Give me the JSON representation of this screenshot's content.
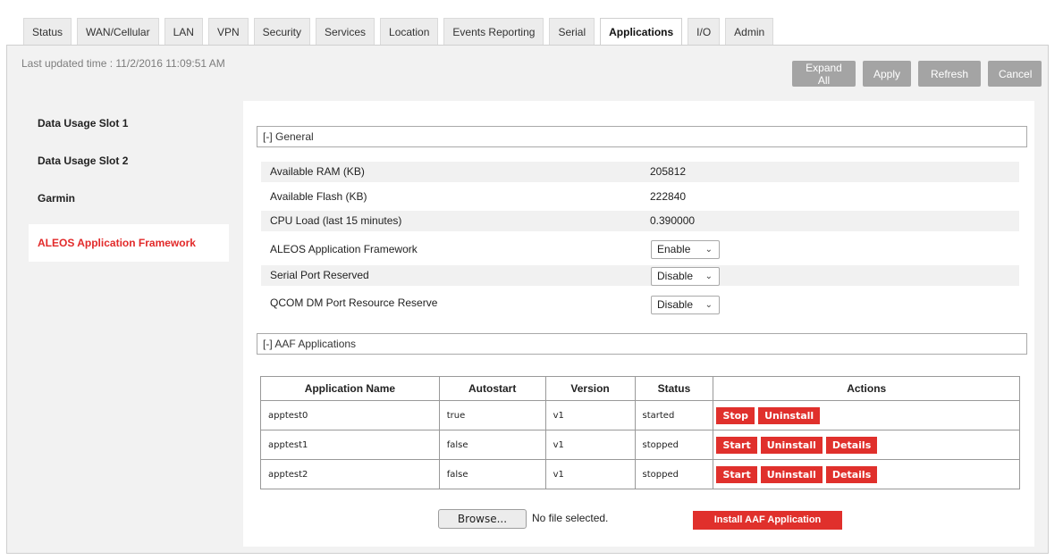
{
  "tabs": [
    {
      "label": "Status"
    },
    {
      "label": "WAN/Cellular"
    },
    {
      "label": "LAN"
    },
    {
      "label": "VPN"
    },
    {
      "label": "Security"
    },
    {
      "label": "Services"
    },
    {
      "label": "Location"
    },
    {
      "label": "Events Reporting"
    },
    {
      "label": "Serial"
    },
    {
      "label": "Applications"
    },
    {
      "label": "I/O"
    },
    {
      "label": "Admin"
    }
  ],
  "active_tab": "Applications",
  "header": {
    "last_updated": "Last updated time : 11/2/2016 11:09:51 AM",
    "buttons": {
      "expand_all": "Expand All",
      "apply": "Apply",
      "refresh": "Refresh",
      "cancel": "Cancel"
    }
  },
  "sidebar": {
    "items": [
      {
        "label": "Data Usage Slot 1"
      },
      {
        "label": "Data Usage Slot 2"
      },
      {
        "label": "Garmin"
      },
      {
        "label": "ALEOS Application Framework"
      }
    ],
    "active": "ALEOS Application Framework"
  },
  "general": {
    "title": "[-] General",
    "rows": [
      {
        "label": "Available RAM (KB)",
        "value": "205812"
      },
      {
        "label": "Available Flash (KB)",
        "value": "222840"
      },
      {
        "label": "CPU Load (last 15 minutes)",
        "value": "0.390000"
      },
      {
        "label": "ALEOS Application Framework",
        "value": "Enable"
      },
      {
        "label": "Serial Port Reserved",
        "value": "Disable"
      },
      {
        "label": "QCOM DM Port Resource Reserve",
        "value": "Disable"
      }
    ]
  },
  "aaf": {
    "title": "[-] AAF Applications",
    "columns": [
      "Application Name",
      "Autostart",
      "Version",
      "Status",
      "Actions"
    ],
    "rows": [
      {
        "name": "apptest0",
        "autostart": "true",
        "version": "v1",
        "status": "started",
        "actions": [
          "Stop",
          "Uninstall"
        ]
      },
      {
        "name": "apptest1",
        "autostart": "false",
        "version": "v1",
        "status": "stopped",
        "actions": [
          "Start",
          "Uninstall",
          "Details"
        ]
      },
      {
        "name": "apptest2",
        "autostart": "false",
        "version": "v1",
        "status": "stopped",
        "actions": [
          "Start",
          "Uninstall",
          "Details"
        ]
      }
    ],
    "browse_label": "Browse...",
    "no_file_text": "No file selected.",
    "install_label": "Install AAF Application"
  },
  "colors": {
    "accent_red": "#e0302c",
    "button_grey": "#a4a4a4",
    "active_sidebar_text": "#e22a2a"
  }
}
